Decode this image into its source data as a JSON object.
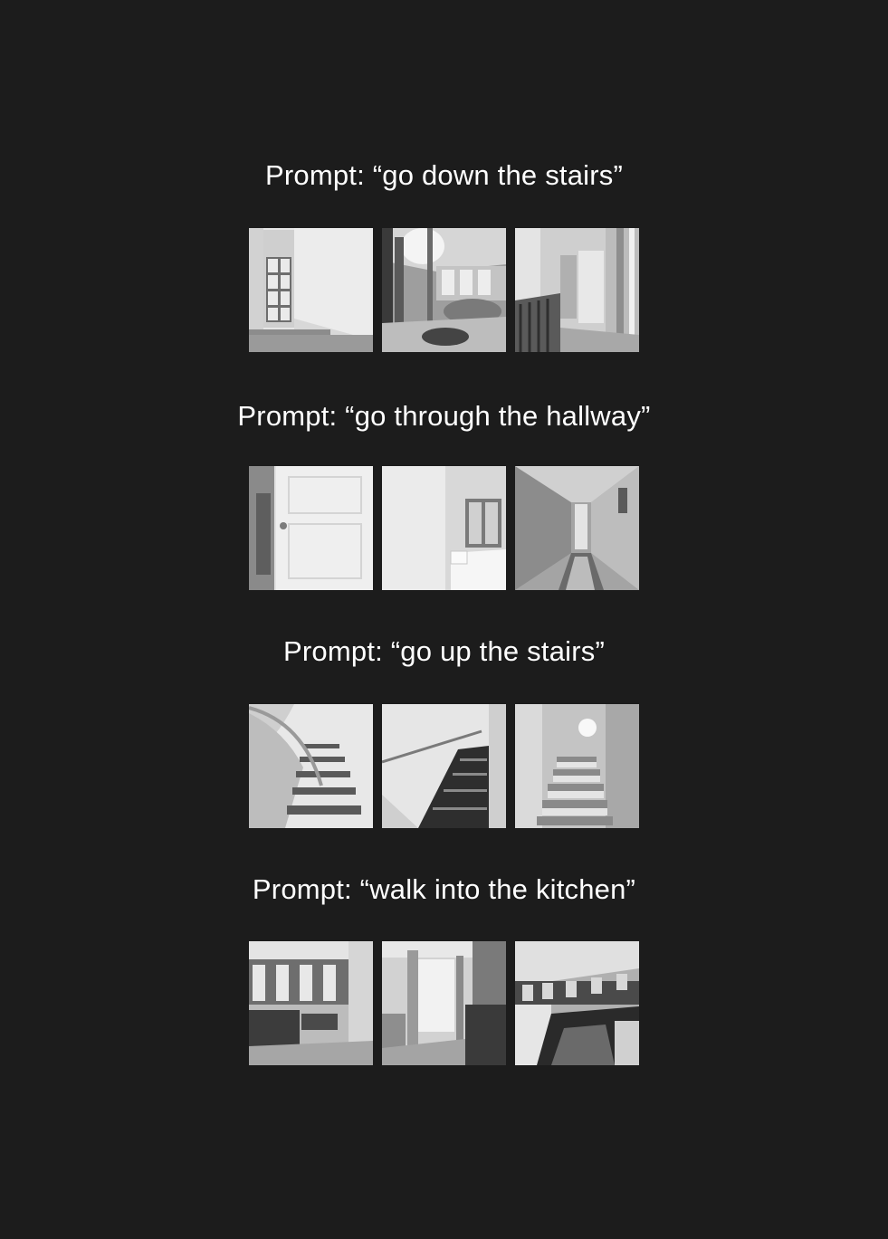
{
  "sections": [
    {
      "prompt": "Prompt: “go down the stairs”",
      "frames": [
        "window-stairwell-frame",
        "living-room-frame",
        "landing-hallway-frame"
      ]
    },
    {
      "prompt": "Prompt: “go through the hallway”",
      "frames": [
        "white-door-frame",
        "bedroom-frame",
        "long-corridor-frame"
      ]
    },
    {
      "prompt": "Prompt: “go up the stairs”",
      "frames": [
        "curved-staircase-frame",
        "dark-staircase-frame",
        "bright-staircase-frame"
      ]
    },
    {
      "prompt": "Prompt: “walk into the kitchen”",
      "frames": [
        "kitchen-island-frame",
        "kitchen-doorway-frame",
        "kitchen-counter-frame"
      ]
    }
  ],
  "colors": {
    "background": "#1c1c1c",
    "text": "#ffffff"
  }
}
